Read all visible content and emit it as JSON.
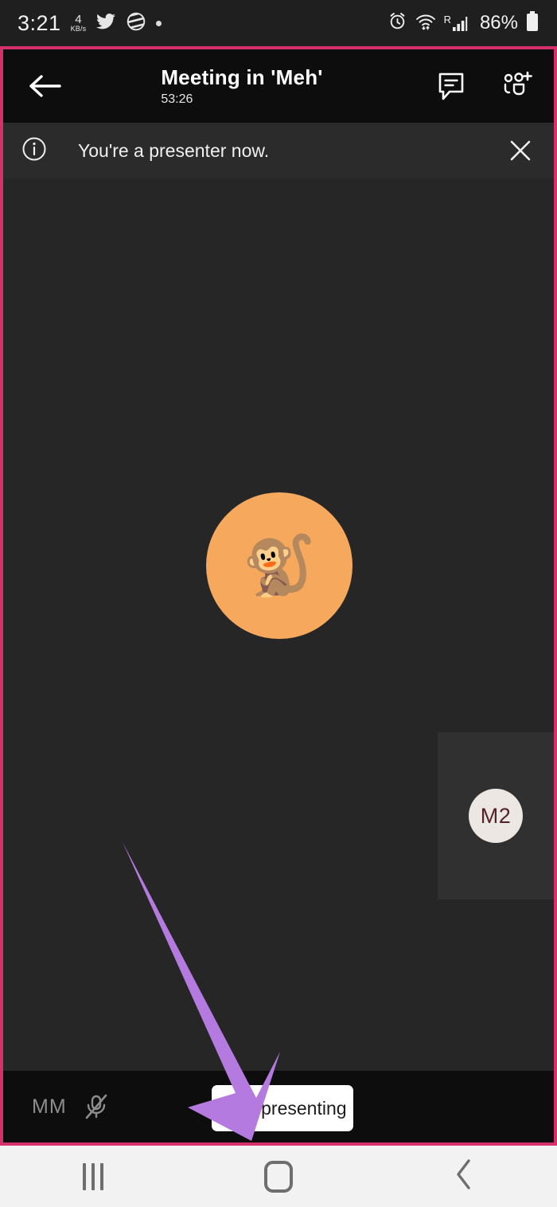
{
  "status_bar": {
    "time": "3:21",
    "network_speed_value": "4",
    "network_speed_unit": "KB/s",
    "app_icons": [
      "twitter-bird-icon",
      "striped-ball-icon",
      "dot-icon"
    ],
    "alarm_icon": "alarm-clock-icon",
    "wifi_icon": "wifi-updown-icon",
    "roaming_label": "R",
    "signal_icon": "signal-bars-icon",
    "battery_percent": "86%",
    "battery_icon": "battery-icon"
  },
  "app_header": {
    "back_icon": "back-arrow-icon",
    "title": "Meeting in 'Meh'",
    "duration": "53:26",
    "chat_icon": "chat-bubble-icon",
    "add_people_icon": "add-participants-icon"
  },
  "banner": {
    "info_icon": "info-circle-icon",
    "message": "You're a presenter now.",
    "close_icon": "close-x-icon"
  },
  "stage": {
    "main_avatar_emoji": "🐒",
    "main_avatar_color": "#f6a85c",
    "thumbnail": {
      "initials": "M2",
      "avatar_bg": "#ece7e3",
      "avatar_text_color": "#55222a"
    }
  },
  "controls": [
    {
      "name": "camera-off-button",
      "icon": "camera-off-icon",
      "state": "disabled"
    },
    {
      "name": "mic-off-button",
      "icon": "mic-off-icon",
      "state": "muted"
    },
    {
      "name": "speaker-button",
      "icon": "speaker-on-icon",
      "state": "on"
    },
    {
      "name": "more-options-button",
      "icon": "more-horizontal-icon",
      "state": "default"
    },
    {
      "name": "end-call-button",
      "icon": "end-call-icon",
      "state": "default",
      "color": "#a51f3f"
    }
  ],
  "bottom_bar": {
    "initials": "MM",
    "mic_icon": "mic-off-icon",
    "stop_presenting_label": "Stop presenting"
  },
  "annotation": {
    "arrow_color": "#b57ae0",
    "points_to": "Stop presenting"
  },
  "nav_bar": {
    "recents_icon": "recents-icon",
    "home_icon": "home-icon",
    "back_icon": "back-chevron-icon"
  },
  "theme": {
    "frame_border": "#d4306a",
    "app_bg": "#262626",
    "header_bg": "#0d0d0d",
    "banner_bg": "#2b2b2b",
    "control_bar_bg": "#3d3d3d"
  }
}
